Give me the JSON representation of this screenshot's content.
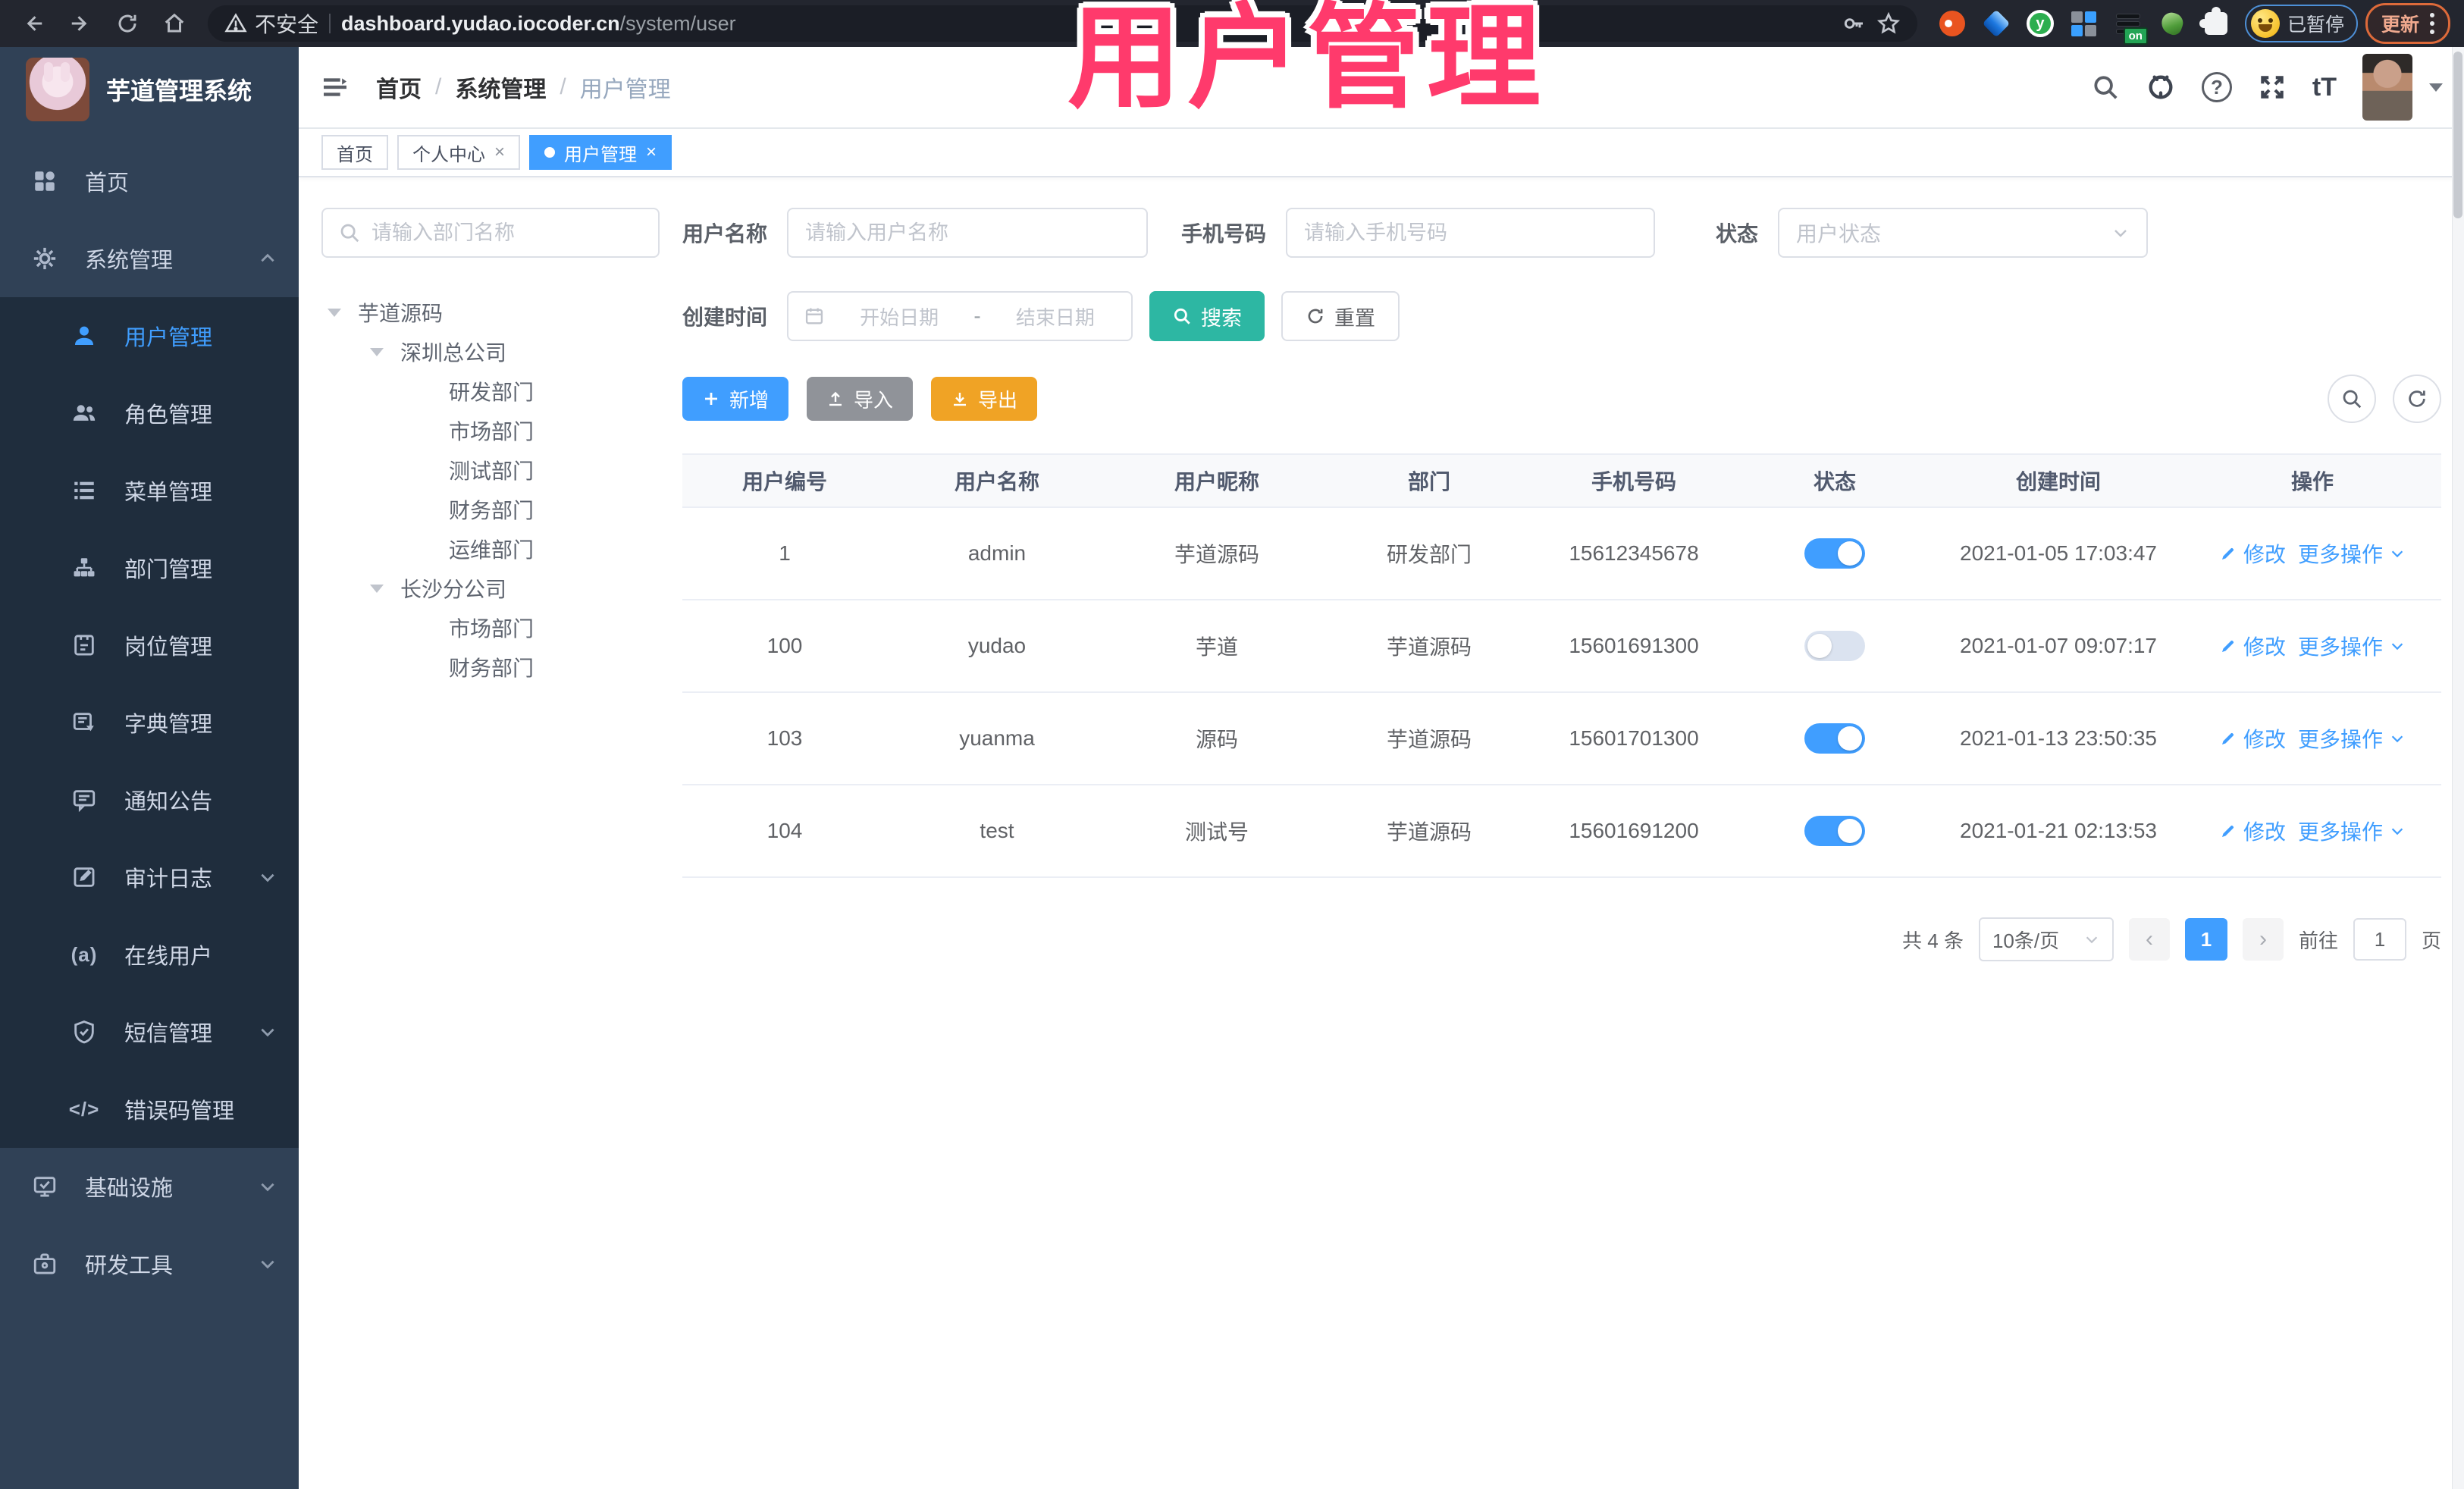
{
  "browser": {
    "security_label": "不安全",
    "url_host": "dashboard.yudao.iocoder.cn",
    "url_path": "/system/user",
    "ext_on_badge": "on",
    "profile_label": "已暂停",
    "update_label": "更新"
  },
  "overlay": {
    "text": "用户管理"
  },
  "sidebar": {
    "logo_title": "芋道管理系统",
    "home": "首页",
    "system": "系统管理",
    "submenu": [
      "用户管理",
      "角色管理",
      "菜单管理",
      "部门管理",
      "岗位管理",
      "字典管理",
      "通知公告",
      "审计日志",
      "在线用户",
      "短信管理",
      "错误码管理"
    ],
    "infra": "基础设施",
    "devtools": "研发工具"
  },
  "glyphs": {
    "online": "(a)",
    "code": "</>",
    "size": "tT",
    "close": "×",
    "prev": "‹",
    "next": "›"
  },
  "breadcrumb": {
    "items": [
      "首页",
      "系统管理",
      "用户管理"
    ],
    "sep": "/"
  },
  "tabs": {
    "home": "首页",
    "profile": "个人中心",
    "user": "用户管理"
  },
  "dept": {
    "search_placeholder": "请输入部门名称",
    "tree": [
      "芋道源码",
      "深圳总公司",
      "研发部门",
      "市场部门",
      "测试部门",
      "财务部门",
      "运维部门",
      "长沙分公司",
      "市场部门",
      "财务部门"
    ]
  },
  "filters": {
    "username_label": "用户名称",
    "username_placeholder": "请输入用户名称",
    "mobile_label": "手机号码",
    "mobile_placeholder": "请输入手机号码",
    "status_label": "状态",
    "status_placeholder": "用户状态",
    "create_time_label": "创建时间",
    "date_start_placeholder": "开始日期",
    "date_separator": "-",
    "date_end_placeholder": "结束日期",
    "search_button": "搜索",
    "reset_button": "重置"
  },
  "toolbar": {
    "add": "新增",
    "import": "导入",
    "export": "导出"
  },
  "table": {
    "columns": [
      "用户编号",
      "用户名称",
      "用户昵称",
      "部门",
      "手机号码",
      "状态",
      "创建时间",
      "操作"
    ],
    "actions": {
      "edit": "修改",
      "more": "更多操作"
    },
    "rows": [
      {
        "id": "1",
        "username": "admin",
        "nickname": "芋道源码",
        "dept": "研发部门",
        "mobile": "15612345678",
        "status": "on",
        "create_time": "2021-01-05 17:03:47"
      },
      {
        "id": "100",
        "username": "yudao",
        "nickname": "芋道",
        "dept": "芋道源码",
        "mobile": "15601691300",
        "status": "off",
        "create_time": "2021-01-07 09:07:17"
      },
      {
        "id": "103",
        "username": "yuanma",
        "nickname": "源码",
        "dept": "芋道源码",
        "mobile": "15601701300",
        "status": "on",
        "create_time": "2021-01-13 23:50:35"
      },
      {
        "id": "104",
        "username": "test",
        "nickname": "测试号",
        "dept": "芋道源码",
        "mobile": "15601691200",
        "status": "on",
        "create_time": "2021-01-21 02:13:53"
      }
    ]
  },
  "pagination": {
    "total": "共 4 条",
    "size": "10条/页",
    "page": "1",
    "goto_label": "前往",
    "goto_value": "1",
    "unit": "页"
  }
}
